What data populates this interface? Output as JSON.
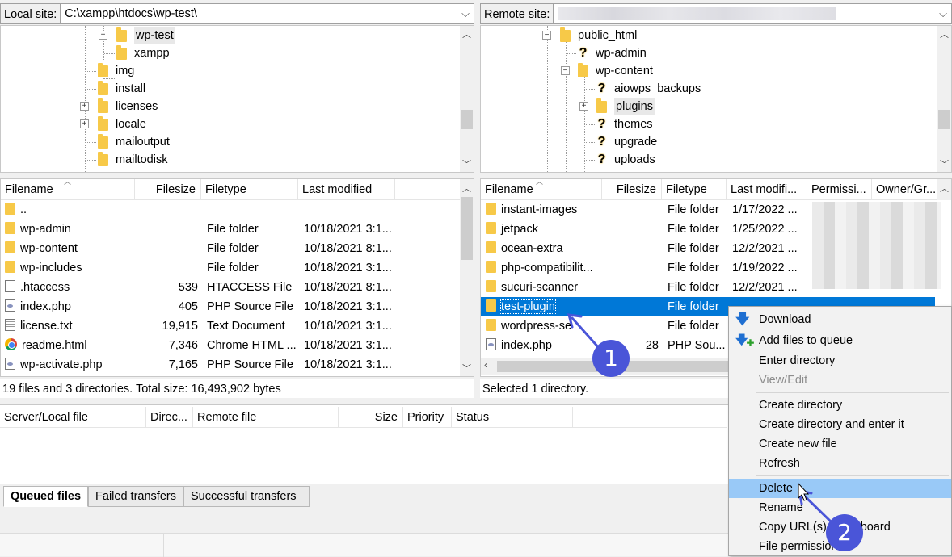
{
  "local_site": {
    "label": "Local site:",
    "path": "C:\\xampp\\htdocs\\wp-test\\"
  },
  "remote_site": {
    "label": "Remote site:"
  },
  "local_tree": [
    {
      "name": "wp-test",
      "kind": "folder"
    },
    {
      "name": "xampp",
      "kind": "folder"
    },
    {
      "name": "img",
      "kind": "folder"
    },
    {
      "name": "install",
      "kind": "folder"
    },
    {
      "name": "licenses",
      "kind": "folder"
    },
    {
      "name": "locale",
      "kind": "folder"
    },
    {
      "name": "mailoutput",
      "kind": "folder"
    },
    {
      "name": "mailtodisk",
      "kind": "folder"
    }
  ],
  "remote_tree": [
    {
      "name": "public_html",
      "kind": "folder"
    },
    {
      "name": "wp-admin",
      "kind": "unknown"
    },
    {
      "name": "wp-content",
      "kind": "folder"
    },
    {
      "name": "aiowps_backups",
      "kind": "unknown"
    },
    {
      "name": "plugins",
      "kind": "folder"
    },
    {
      "name": "themes",
      "kind": "unknown"
    },
    {
      "name": "upgrade",
      "kind": "unknown"
    },
    {
      "name": "uploads",
      "kind": "unknown"
    }
  ],
  "local_list": {
    "columns": {
      "filename": "Filename",
      "filesize": "Filesize",
      "filetype": "Filetype",
      "modified": "Last modified"
    },
    "rows": [
      {
        "name": "..",
        "size": "",
        "type": "",
        "modified": "",
        "icon": "folder"
      },
      {
        "name": "wp-admin",
        "size": "",
        "type": "File folder",
        "modified": "10/18/2021 3:1...",
        "icon": "folder"
      },
      {
        "name": "wp-content",
        "size": "",
        "type": "File folder",
        "modified": "10/18/2021 8:1...",
        "icon": "folder"
      },
      {
        "name": "wp-includes",
        "size": "",
        "type": "File folder",
        "modified": "10/18/2021 3:1...",
        "icon": "folder"
      },
      {
        "name": ".htaccess",
        "size": "539",
        "type": "HTACCESS File",
        "modified": "10/18/2021 8:1...",
        "icon": "file"
      },
      {
        "name": "index.php",
        "size": "405",
        "type": "PHP Source File",
        "modified": "10/18/2021 3:1...",
        "icon": "php"
      },
      {
        "name": "license.txt",
        "size": "19,915",
        "type": "Text Document",
        "modified": "10/18/2021 3:1...",
        "icon": "txt"
      },
      {
        "name": "readme.html",
        "size": "7,346",
        "type": "Chrome HTML ...",
        "modified": "10/18/2021 3:1...",
        "icon": "chrome"
      },
      {
        "name": "wp-activate.php",
        "size": "7,165",
        "type": "PHP Source File",
        "modified": "10/18/2021 3:1...",
        "icon": "php"
      }
    ],
    "status": "19 files and 3 directories. Total size: 16,493,902 bytes"
  },
  "remote_list": {
    "columns": {
      "filename": "Filename",
      "filesize": "Filesize",
      "filetype": "Filetype",
      "modified": "Last modifi...",
      "perms": "Permissi...",
      "owner": "Owner/Gr..."
    },
    "rows": [
      {
        "name": "instant-images",
        "size": "",
        "type": "File folder",
        "modified": "1/17/2022 ...",
        "icon": "folder"
      },
      {
        "name": "jetpack",
        "size": "",
        "type": "File folder",
        "modified": "1/25/2022 ...",
        "icon": "folder"
      },
      {
        "name": "ocean-extra",
        "size": "",
        "type": "File folder",
        "modified": "12/2/2021 ...",
        "icon": "folder"
      },
      {
        "name": "php-compatibilit...",
        "size": "",
        "type": "File folder",
        "modified": "1/19/2022 ...",
        "icon": "folder"
      },
      {
        "name": "sucuri-scanner",
        "size": "",
        "type": "File folder",
        "modified": "12/2/2021 ...",
        "icon": "folder"
      },
      {
        "name": "test-plugin",
        "size": "",
        "type": "File folder",
        "modified": "",
        "icon": "folder",
        "selected": true
      },
      {
        "name": "wordpress-se",
        "size": "",
        "type": "File folder",
        "modified": "",
        "icon": "folder"
      },
      {
        "name": "index.php",
        "size": "28",
        "type": "PHP Sou...",
        "modified": "",
        "icon": "php"
      }
    ],
    "status": "Selected 1 directory."
  },
  "queue": {
    "columns": {
      "server_local": "Server/Local file",
      "direction": "Direc...",
      "remote": "Remote file",
      "size": "Size",
      "priority": "Priority",
      "status": "Status"
    },
    "tabs": [
      "Queued files",
      "Failed transfers",
      "Successful transfers"
    ]
  },
  "context_menu": {
    "items": [
      {
        "label": "Download",
        "icon": "download-arrow-icon"
      },
      {
        "label": "Add files to queue",
        "icon": "add-to-queue-icon"
      },
      {
        "label": "Enter directory"
      },
      {
        "label": "View/Edit",
        "disabled": true
      },
      {
        "label": "Create directory"
      },
      {
        "label": "Create directory and enter it"
      },
      {
        "label": "Create new file"
      },
      {
        "label": "Refresh"
      },
      {
        "label": "Delete",
        "highlighted": true
      },
      {
        "label": "Rename"
      },
      {
        "label": "Copy URL(s) to clipboard"
      },
      {
        "label": "File permissions..."
      }
    ]
  },
  "annotations": [
    "1",
    "2"
  ],
  "colors": {
    "selection": "#0078d7",
    "menu_highlight": "#99c9f7",
    "badge": "#4a55d8",
    "folder": "#f7c948"
  }
}
